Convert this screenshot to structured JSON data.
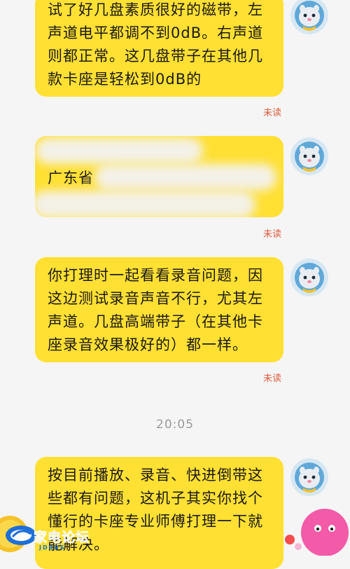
{
  "colors": {
    "bubble": "#ffe033",
    "unread": "#e05a3a",
    "background": "#f5f5f5",
    "timestamp": "#9a9a9a"
  },
  "messages": [
    {
      "lines": [
        "试了好几盘素质很好的磁带，左",
        "声道电平都调不到0dB。右声道",
        "则都正常。这几盘带子在其他几",
        "款卡座是轻松到0dB的"
      ],
      "status": "未读",
      "avatar": "seal-astronaut-avatar"
    },
    {
      "lines": [
        "",
        "广东省",
        ""
      ],
      "status": "未读",
      "avatar": "seal-astronaut-avatar",
      "blurred": true
    },
    {
      "lines": [
        "你打理时一起看看录音问题，因",
        "这边测试录音声音不行，尤其左",
        "声道。几盘高端带子（在其他卡",
        "座录音效果极好的）都一样。"
      ],
      "status": "未读",
      "avatar": "seal-astronaut-avatar"
    },
    {
      "lines": [
        "按目前播放、录音、快进倒带这",
        "些都有问题，这机子其实你找个",
        "懂行的卡座专业师傅打理一下就",
        "能解决。"
      ],
      "avatar": "seal-astronaut-avatar"
    }
  ],
  "timestamp": "20:05",
  "watermark": {
    "title": "家电论坛",
    "sub": "JDBBS"
  }
}
